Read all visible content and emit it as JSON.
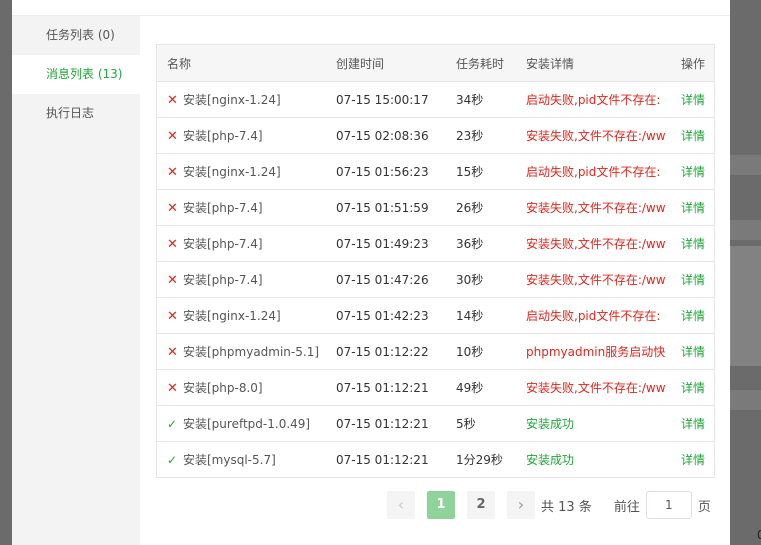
{
  "sidebar": {
    "items": [
      {
        "label": "任务列表 (0)",
        "active": false
      },
      {
        "label": "消息列表 (13)",
        "active": true
      },
      {
        "label": "执行日志",
        "active": false
      }
    ]
  },
  "table": {
    "headers": {
      "name": "名称",
      "time": "创建时间",
      "duration": "任务耗时",
      "detail": "安装详情",
      "op": "操作"
    },
    "rows": [
      {
        "status": "fail",
        "name": "安装[nginx-1.24]",
        "time": "07-15 15:00:17",
        "duration": "34秒",
        "detail": "启动失败,pid文件不存在:",
        "op": "详情"
      },
      {
        "status": "fail",
        "name": "安装[php-7.4]",
        "time": "07-15 02:08:36",
        "duration": "23秒",
        "detail": "安装失败,文件不存在:/ww",
        "op": "详情"
      },
      {
        "status": "fail",
        "name": "安装[nginx-1.24]",
        "time": "07-15 01:56:23",
        "duration": "15秒",
        "detail": "启动失败,pid文件不存在:",
        "op": "详情"
      },
      {
        "status": "fail",
        "name": "安装[php-7.4]",
        "time": "07-15 01:51:59",
        "duration": "26秒",
        "detail": "安装失败,文件不存在:/ww",
        "op": "详情"
      },
      {
        "status": "fail",
        "name": "安装[php-7.4]",
        "time": "07-15 01:49:23",
        "duration": "36秒",
        "detail": "安装失败,文件不存在:/ww",
        "op": "详情"
      },
      {
        "status": "fail",
        "name": "安装[php-7.4]",
        "time": "07-15 01:47:26",
        "duration": "30秒",
        "detail": "安装失败,文件不存在:/ww",
        "op": "详情"
      },
      {
        "status": "fail",
        "name": "安装[nginx-1.24]",
        "time": "07-15 01:42:23",
        "duration": "14秒",
        "detail": "启动失败,pid文件不存在:",
        "op": "详情"
      },
      {
        "status": "fail",
        "name": "安装[phpmyadmin-5.1]",
        "time": "07-15 01:12:22",
        "duration": "10秒",
        "detail": "phpmyadmin服务启动快",
        "op": "详情"
      },
      {
        "status": "fail",
        "name": "安装[php-8.0]",
        "time": "07-15 01:12:21",
        "duration": "49秒",
        "detail": "安装失败,文件不存在:/ww",
        "op": "详情"
      },
      {
        "status": "ok",
        "name": "安装[pureftpd-1.0.49]",
        "time": "07-15 01:12:21",
        "duration": "5秒",
        "detail": "安装成功",
        "op": "详情"
      },
      {
        "status": "ok",
        "name": "安装[mysql-5.7]",
        "time": "07-15 01:12:21",
        "duration": "1分29秒",
        "detail": "安装成功",
        "op": "详情"
      }
    ]
  },
  "pagination": {
    "prev_icon": "chevron-left-icon",
    "next_icon": "chevron-right-icon",
    "pages": [
      "1",
      "2"
    ],
    "current": "1",
    "total_text": "共 13 条",
    "goto_label": "前往",
    "goto_value": "1",
    "goto_suffix": "页"
  },
  "icons": {
    "fail": "cross-icon",
    "success": "check-icon"
  },
  "colors": {
    "accent": "#20a53a",
    "error": "#e0261c",
    "current_page": "#8fd39b"
  }
}
